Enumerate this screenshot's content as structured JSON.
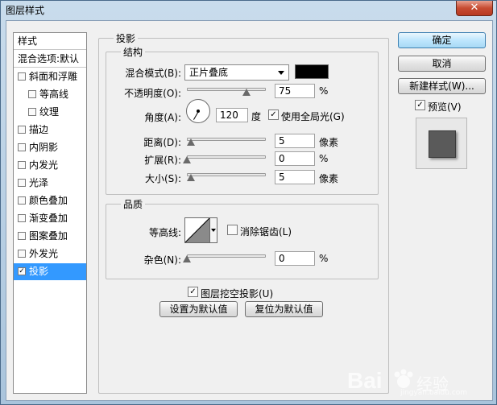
{
  "window": {
    "title": "图层样式",
    "close_glyph": "✕"
  },
  "left_panel": {
    "header": "样式",
    "blend_options": "混合选项:默认",
    "items": [
      {
        "label": "斜面和浮雕",
        "checked": false,
        "indent": false
      },
      {
        "label": "等高线",
        "checked": false,
        "indent": true
      },
      {
        "label": "纹理",
        "checked": false,
        "indent": true
      },
      {
        "label": "描边",
        "checked": false,
        "indent": false
      },
      {
        "label": "内阴影",
        "checked": false,
        "indent": false
      },
      {
        "label": "内发光",
        "checked": false,
        "indent": false
      },
      {
        "label": "光泽",
        "checked": false,
        "indent": false
      },
      {
        "label": "颜色叠加",
        "checked": false,
        "indent": false
      },
      {
        "label": "渐变叠加",
        "checked": false,
        "indent": false
      },
      {
        "label": "图案叠加",
        "checked": false,
        "indent": false
      },
      {
        "label": "外发光",
        "checked": false,
        "indent": false
      },
      {
        "label": "投影",
        "checked": true,
        "indent": false,
        "selected": true
      }
    ]
  },
  "panel": {
    "title": "投影",
    "structure": {
      "title": "结构",
      "blend_mode_label": "混合模式(B):",
      "blend_mode_value": "正片叠底",
      "shadow_color": "#000000",
      "opacity_label": "不透明度(O):",
      "opacity_value": "75",
      "opacity_unit": "%",
      "opacity_fraction": 0.75,
      "angle_label": "角度(A):",
      "angle_value": "120",
      "angle_unit": "度",
      "global_light_label": "使用全局光(G)",
      "global_light_checked": true,
      "distance_label": "距离(D):",
      "distance_value": "5",
      "distance_unit": "像素",
      "spread_label": "扩展(R):",
      "spread_value": "0",
      "spread_unit": "%",
      "size_label": "大小(S):",
      "size_value": "5",
      "size_unit": "像素"
    },
    "quality": {
      "title": "品质",
      "contour_label": "等高线:",
      "anti_alias_label": "消除锯齿(L)",
      "anti_alias_checked": false,
      "noise_label": "杂色(N):",
      "noise_value": "0",
      "noise_unit": "%"
    },
    "knockout_label": "图层挖空投影(U)",
    "knockout_checked": true,
    "make_default": "设置为默认值",
    "reset_default": "复位为默认值"
  },
  "right_buttons": {
    "ok": "确定",
    "cancel": "取消",
    "new_style": "新建样式(W)...",
    "preview_label": "预览(V)",
    "preview_checked": true
  },
  "check_glyph": "✓",
  "watermark": {
    "text": "Bai",
    "text2": "经验",
    "brand": "jingyan.baidu.com"
  }
}
